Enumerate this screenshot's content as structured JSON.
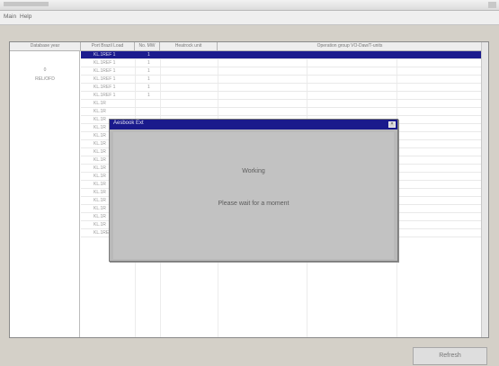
{
  "menu": {
    "items": [
      "Main",
      "Help"
    ]
  },
  "table": {
    "headers": [
      "Database year",
      "Port Brazil Load",
      "No. MW",
      "Heatrock unit",
      "Operation group VO-Daw/T-units"
    ],
    "group_value": "0",
    "group_label": "REL/OFD",
    "rows": [
      {
        "a": "KL.1REF 1",
        "b": "1"
      },
      {
        "a": "KL.1REF 1",
        "b": "1"
      },
      {
        "a": "KL.1REF 1",
        "b": "1"
      },
      {
        "a": "KL.1REF 1",
        "b": "1"
      },
      {
        "a": "KL.1REF 1",
        "b": "1"
      },
      {
        "a": "KL.1REF 1",
        "b": "1"
      },
      {
        "a": "KL.1R",
        "b": ""
      },
      {
        "a": "KL.1R",
        "b": ""
      },
      {
        "a": "KL.1R",
        "b": ""
      },
      {
        "a": "KL.1R",
        "b": ""
      },
      {
        "a": "KL.1R",
        "b": ""
      },
      {
        "a": "KL.1R",
        "b": ""
      },
      {
        "a": "KL.1R",
        "b": ""
      },
      {
        "a": "KL.1R",
        "b": ""
      },
      {
        "a": "KL.1R",
        "b": ""
      },
      {
        "a": "KL.1R",
        "b": ""
      },
      {
        "a": "KL.1R",
        "b": ""
      },
      {
        "a": "KL.1R",
        "b": ""
      },
      {
        "a": "KL.1R",
        "b": ""
      },
      {
        "a": "KL.1R",
        "b": ""
      },
      {
        "a": "KL.1R",
        "b": ""
      },
      {
        "a": "KL.1R",
        "b": ""
      },
      {
        "a": "KL.1REF 1",
        "b": "1"
      }
    ]
  },
  "dialog": {
    "title": "Aesbook Ext",
    "close": "×",
    "message1": "Working",
    "message2": "Please wait for a moment"
  },
  "buttons": {
    "refresh": "Refresh"
  },
  "colors": {
    "selection": "#1c1c8e",
    "dialog_title": "#1a1a8c"
  }
}
